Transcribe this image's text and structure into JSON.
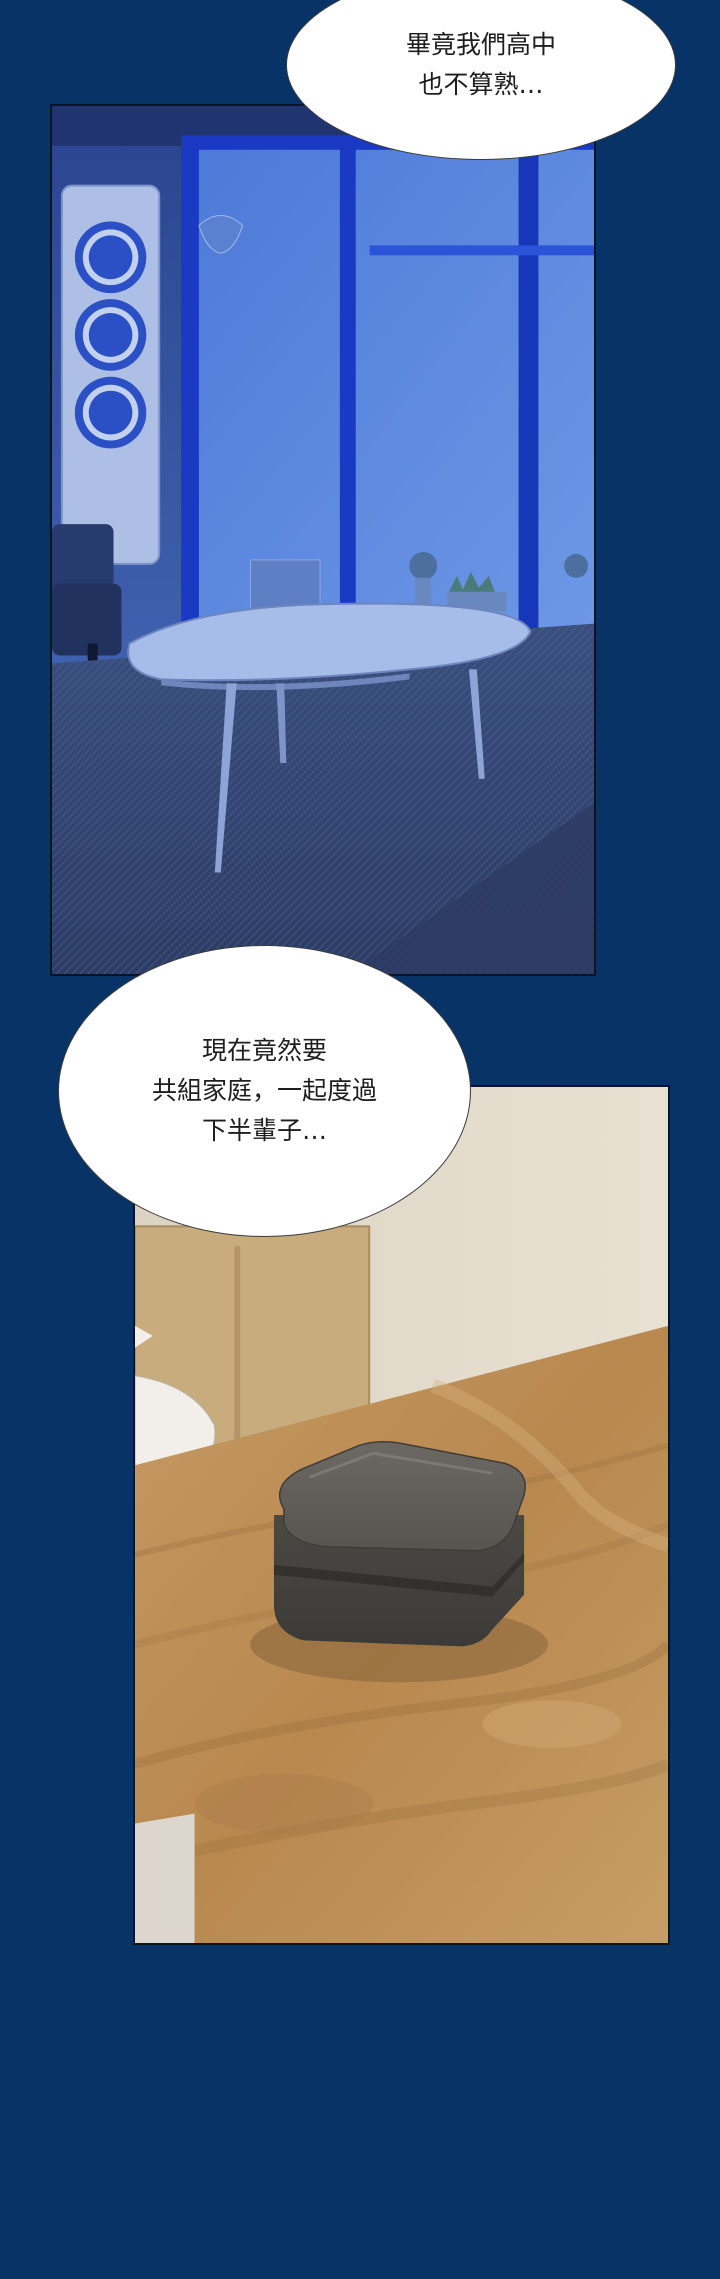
{
  "panels": [
    {
      "scene": "living-room-night",
      "dialogue": [
        "畢竟我們高中",
        "也不算熟…"
      ]
    },
    {
      "scene": "ring-box-on-table",
      "dialogue": [
        "現在竟然要",
        "共組家庭，一起度過",
        "下半輩子…"
      ]
    }
  ],
  "colors": {
    "background": "#073366",
    "night_wall": "#3d5fae",
    "window_blue": "#1c4fd6",
    "table_wood": "#b98a52",
    "ring_box": "#595651"
  }
}
